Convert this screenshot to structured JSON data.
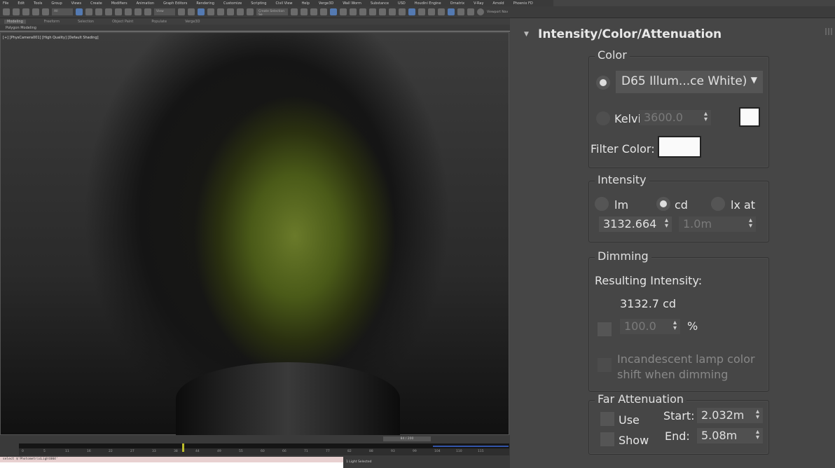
{
  "menu": [
    "File",
    "Edit",
    "Tools",
    "Group",
    "Views",
    "Create",
    "Modifiers",
    "Animation",
    "Graph Editors",
    "Rendering",
    "Customize",
    "Scripting",
    "Civil View",
    "Help",
    "Verge3D",
    "Wall Worm",
    "Substance",
    "USD",
    "Houdini Engine",
    "Ornatrix",
    "V-Ray",
    "Arnold",
    "Phoenix FD"
  ],
  "toolbar": {
    "filter": "All",
    "ref_coord": "View",
    "selection_set": "Create Selection Se",
    "viewport_nav": "Viewport Nav"
  },
  "ribbon": {
    "tabs": [
      "Modeling",
      "Freeform",
      "Selection",
      "Object Paint",
      "Populate",
      "Verge3D"
    ],
    "sub": "Polygon Modeling"
  },
  "viewport": {
    "label": "[+] [PhysCamera001] [High Quality] [Default Shading]"
  },
  "timeline": {
    "frame": "84 / 200",
    "current_fraction": 0.42,
    "ticks": [
      "0",
      "5",
      "11",
      "16",
      "22",
      "27",
      "33",
      "38",
      "44",
      "49",
      "55",
      "60",
      "66",
      "71",
      "77",
      "82",
      "88",
      "93",
      "99",
      "104",
      "110",
      "115"
    ]
  },
  "command": {
    "line": "select $'PhotometricLight004'"
  },
  "status": {
    "text": "1 Light Selected"
  },
  "panel": {
    "title": "Intensity/Color/Attenuation",
    "color": {
      "label": "Color",
      "preset": "D65 Illum...ce White)",
      "kelvin_label": "Kelvin:",
      "kelvin": "3600.0",
      "filter_label": "Filter Color:"
    },
    "intensity": {
      "label": "Intensity",
      "units": [
        "lm",
        "cd",
        "lx at"
      ],
      "value": "3132.664",
      "distance": "1.0m"
    },
    "dimming": {
      "label": "Dimming",
      "result_label": "Resulting Intensity:",
      "result": "3132.7 cd",
      "percent": "100.0",
      "percent_sign": "%",
      "incandescent": "Incandescent lamp color shift when dimming"
    },
    "far": {
      "label": "Far Attenuation",
      "use": "Use",
      "show": "Show",
      "start_label": "Start:",
      "start": "2.032m",
      "end_label": "End:",
      "end": "5.08m"
    }
  }
}
